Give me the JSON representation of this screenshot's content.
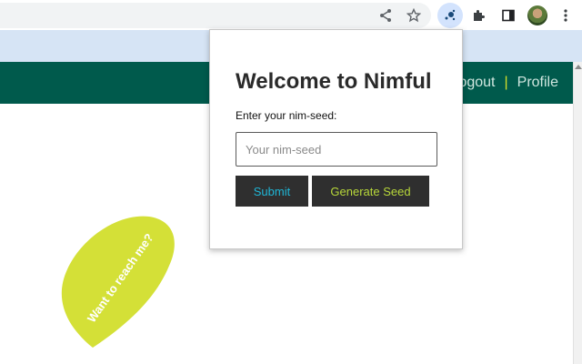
{
  "browser": {
    "toolbar_icons": [
      "share-icon",
      "star-icon",
      "nimful-extension-icon",
      "puzzle-icon",
      "side-panel-icon",
      "avatar",
      "menu-icon"
    ]
  },
  "header": {
    "logout": "Logout",
    "separator": "|",
    "profile": "Profile",
    "background_color": "#005a4c"
  },
  "leaf": {
    "text": "Want to reach me?",
    "color": "#d4e037"
  },
  "popup": {
    "title": "Welcome to Nimful",
    "label": "Enter your nim-seed:",
    "input_placeholder": "Your nim-seed",
    "input_value": "",
    "submit_label": "Submit",
    "generate_label": "Generate Seed"
  }
}
